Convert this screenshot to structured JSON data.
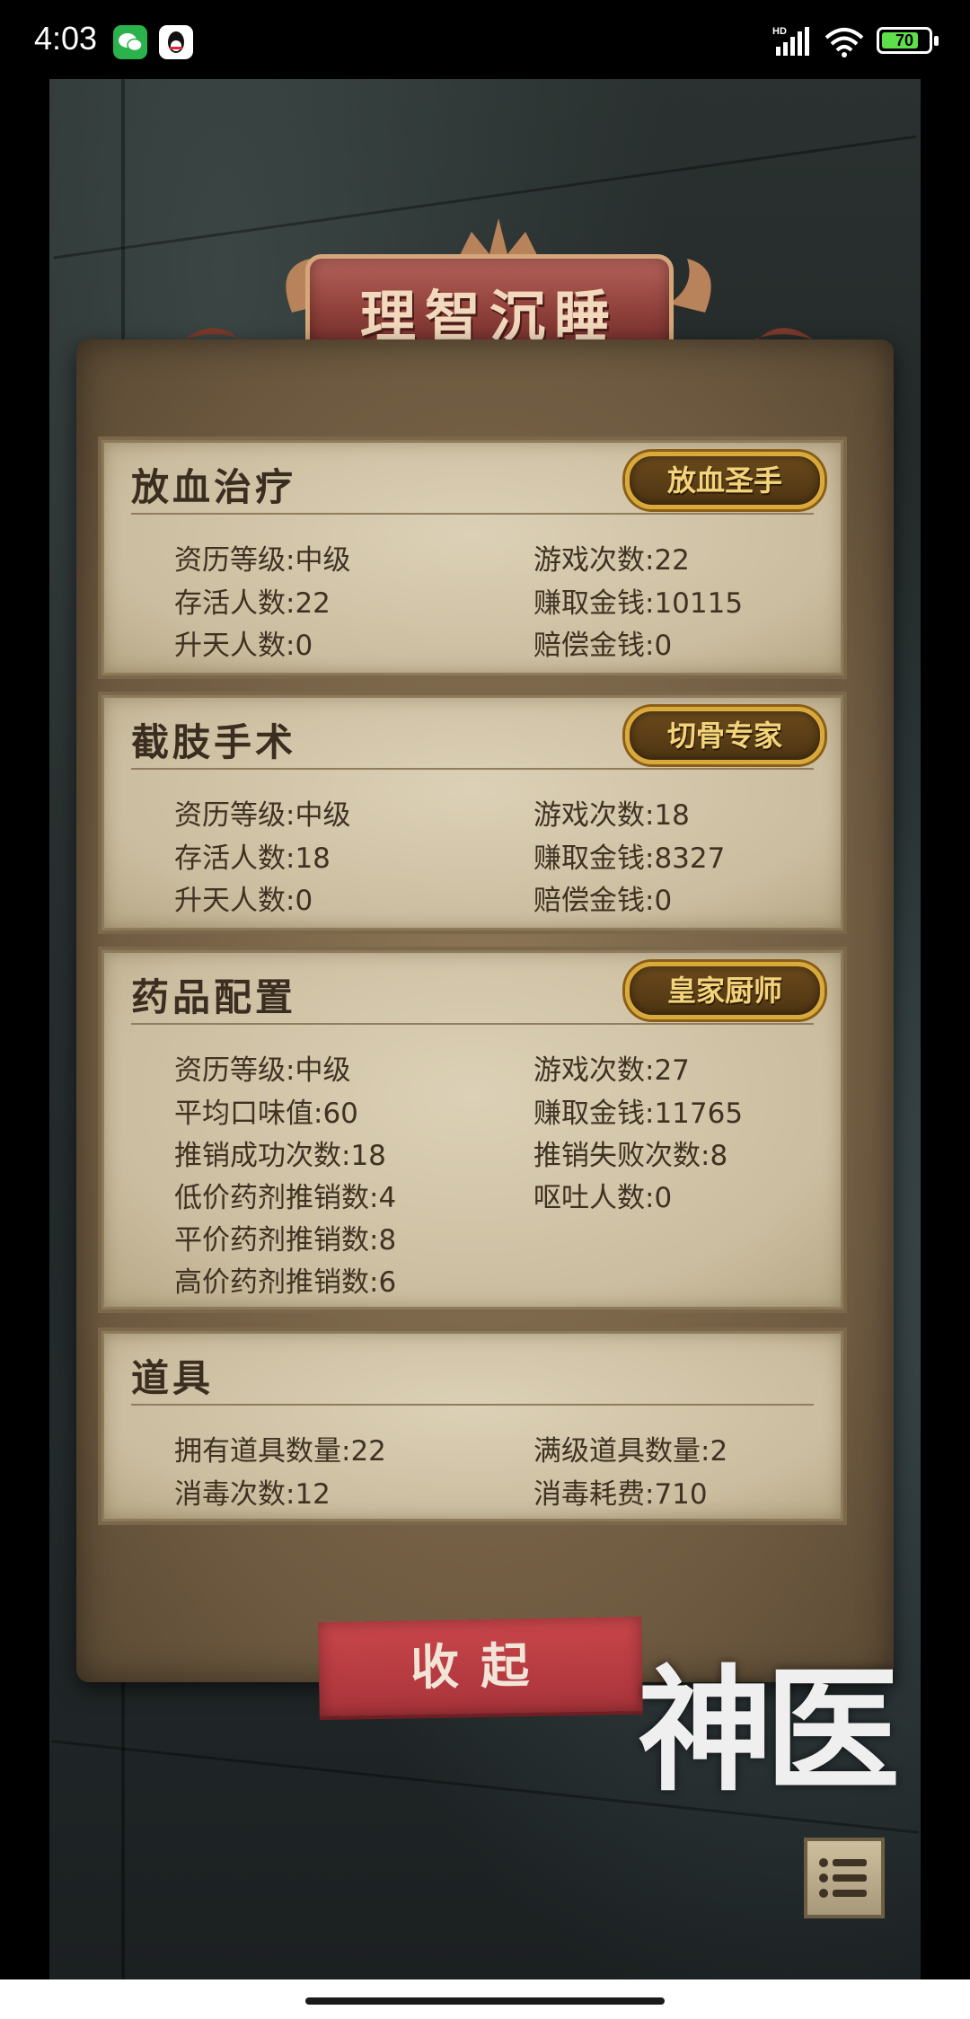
{
  "status_bar": {
    "time": "4:03",
    "network": "HD",
    "battery": "70"
  },
  "banner": {
    "title": "理智沉睡"
  },
  "sections": [
    {
      "title": "放血治疗",
      "badge": "放血圣手",
      "stats": [
        {
          "label": "资历等级:",
          "value": "中级"
        },
        {
          "label": "游戏次数:",
          "value": "22"
        },
        {
          "label": "存活人数:",
          "value": "22"
        },
        {
          "label": "赚取金钱:",
          "value": "10115"
        },
        {
          "label": "升天人数:",
          "value": "0"
        },
        {
          "label": "赔偿金钱:",
          "value": "0"
        }
      ]
    },
    {
      "title": "截肢手术",
      "badge": "切骨专家",
      "stats": [
        {
          "label": "资历等级:",
          "value": "中级"
        },
        {
          "label": "游戏次数:",
          "value": "18"
        },
        {
          "label": "存活人数:",
          "value": "18"
        },
        {
          "label": "赚取金钱:",
          "value": "8327"
        },
        {
          "label": "升天人数:",
          "value": "0"
        },
        {
          "label": "赔偿金钱:",
          "value": "0"
        }
      ]
    },
    {
      "title": "药品配置",
      "badge": "皇家厨师",
      "stats": [
        {
          "label": "资历等级:",
          "value": "中级"
        },
        {
          "label": "游戏次数:",
          "value": "27"
        },
        {
          "label": "平均口味值:",
          "value": "60"
        },
        {
          "label": "赚取金钱:",
          "value": "11765"
        },
        {
          "label": "推销成功次数:",
          "value": "18"
        },
        {
          "label": "推销失败次数:",
          "value": "8"
        },
        {
          "label": "低价药剂推销数:",
          "value": "4"
        },
        {
          "label": "呕吐人数:",
          "value": "0"
        },
        {
          "label": "平价药剂推销数:",
          "value": "8"
        },
        {
          "label": "高价药剂推销数:",
          "value": "6"
        }
      ]
    },
    {
      "title": "道具",
      "stats": [
        {
          "label": "拥有道具数量:",
          "value": "22"
        },
        {
          "label": "满级道具数量:",
          "value": "2"
        },
        {
          "label": "消毒次数:",
          "value": "12"
        },
        {
          "label": "消毒耗费:",
          "value": "710"
        }
      ]
    }
  ],
  "collapse_button": {
    "label": "收起"
  },
  "logo": {
    "text": "神医"
  },
  "icons": {
    "menu": "list-menu-icon",
    "wechat": "wechat-icon",
    "qq": "qq-icon",
    "signal": "signal-icon",
    "wifi": "wifi-icon",
    "battery": "battery-icon"
  },
  "colors": {
    "banner": "#9a4640",
    "parchment": "#cbbd9f",
    "badge_gold": "#d9a93b",
    "button_red": "#c1424a"
  }
}
